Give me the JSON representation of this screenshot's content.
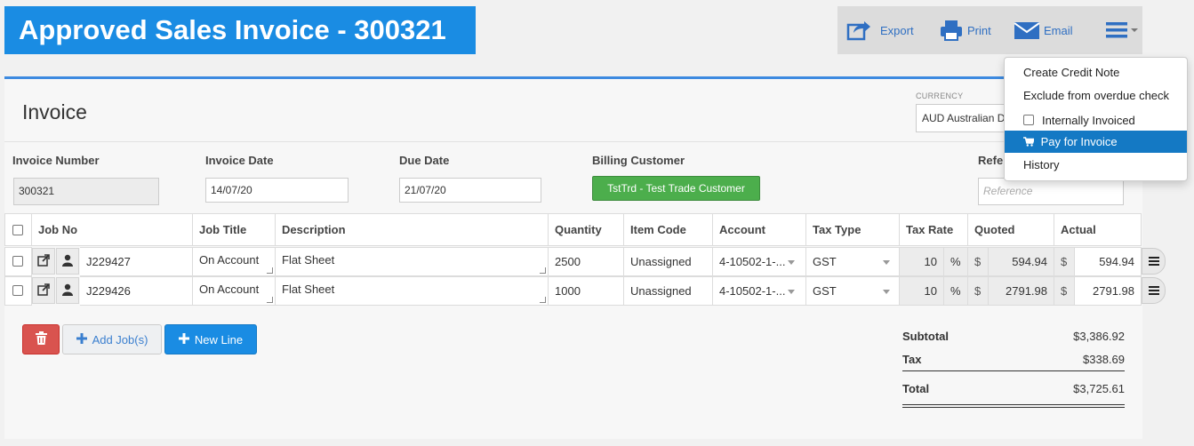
{
  "page": {
    "title": "Approved Sales Invoice - 300321"
  },
  "toolbar": {
    "export_label": "Export",
    "print_label": "Print",
    "email_label": "Email",
    "menu_icon": "hamburger-menu-icon"
  },
  "dropdown_menu": {
    "items": [
      {
        "label": "Create Credit Note"
      },
      {
        "label": "Exclude from overdue check"
      },
      {
        "label": "Internally Invoiced",
        "checkbox": true,
        "checked": false
      },
      {
        "label": "Pay for Invoice",
        "icon": "cart-icon",
        "highlighted": true
      },
      {
        "label": "History"
      }
    ]
  },
  "invoice": {
    "section_title": "Invoice",
    "currency_label": "CURRENCY",
    "currency_value": "AUD Australian Do",
    "invoice_number_label": "Invoice Number",
    "invoice_number": "300321",
    "invoice_date_label": "Invoice Date",
    "invoice_date": "14/07/20",
    "due_date_label": "Due Date",
    "due_date": "21/07/20",
    "billing_customer_label": "Billing Customer",
    "billing_customer": "TstTrd - Test Trade Customer",
    "reference_label": "Refe",
    "reference_placeholder": "Reference"
  },
  "table": {
    "headers": {
      "job_no": "Job No",
      "job_title": "Job Title",
      "description": "Description",
      "quantity": "Quantity",
      "item_code": "Item Code",
      "account": "Account",
      "tax_type": "Tax Type",
      "tax_rate": "Tax Rate",
      "quoted": "Quoted",
      "actual": "Actual"
    },
    "currency_symbol": "$",
    "percent_symbol": "%",
    "rows": [
      {
        "job_no": "J229427",
        "job_title": "On Account",
        "description": "Flat Sheet",
        "quantity": "2500",
        "item_code": "Unassigned",
        "account": "4-10502-1-...",
        "tax_type": "GST",
        "tax_rate": "10",
        "quoted": "594.94",
        "actual": "594.94"
      },
      {
        "job_no": "J229426",
        "job_title": "On Account",
        "description": "Flat Sheet",
        "quantity": "1000",
        "item_code": "Unassigned",
        "account": "4-10502-1-...",
        "tax_type": "GST",
        "tax_rate": "10",
        "quoted": "2791.98",
        "actual": "2791.98"
      }
    ]
  },
  "actions": {
    "add_jobs_label": "Add Job(s)",
    "new_line_label": "New Line"
  },
  "totals": {
    "subtotal_label": "Subtotal",
    "subtotal": "$3,386.92",
    "tax_label": "Tax",
    "tax": "$338.69",
    "total_label": "Total",
    "total": "$3,725.61"
  },
  "colors": {
    "title_bg": "#1a8ce3",
    "accent_blue": "#1479c4",
    "customer_green": "#4cae4c",
    "delete_red": "#d9534f"
  }
}
